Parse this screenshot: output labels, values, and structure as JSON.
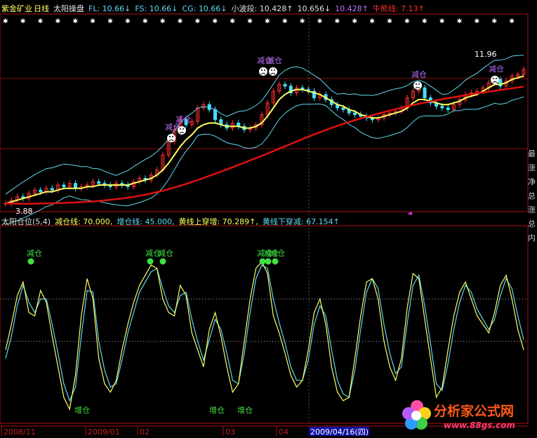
{
  "header": {
    "stock_name": "紫金矿业",
    "period": "日线",
    "indicator": "太阳操盘",
    "fl": "FL: 10.66↓",
    "fs": "FS: 10.66↓",
    "cg": "CG: 10.66↓",
    "xiaobo_label": "小波段: 10.428↑",
    "v2": "10.656↓",
    "v3": "10.428↑",
    "niu": "牛熊线: 7.13↑"
  },
  "upper": {
    "high_label": "11.96",
    "low_label": "3.88",
    "annotations": [
      "减仓",
      "减仓",
      "减仓",
      "减仓",
      "减仓",
      "减仓",
      "减仓"
    ]
  },
  "lower": {
    "header": {
      "name": "太阳仓位(5,4)",
      "jian": "减仓线: 70.000,",
      "zeng": "增仓线: 45.000,",
      "up": "黄线上穿增: 70.289↑,",
      "down": "黄线下穿减: 67.154↑"
    },
    "jian_labels": [
      "减仓",
      "减仓",
      "减仓",
      "减仓",
      "减仓",
      "减仓"
    ],
    "zeng_labels": [
      "增仓",
      "增仓",
      "增仓"
    ]
  },
  "xaxis": {
    "labels": [
      "2008/11",
      "2009/01",
      "02",
      "03",
      "04",
      "2009/04/16(四)"
    ]
  },
  "right_side_text": "最\n涨\n净\n总\n涨\n总\n内",
  "logo": {
    "name": "分析家公式网",
    "url": "www.88gs.com"
  },
  "colors": {
    "up": "#ff3030",
    "down": "#40e0ff",
    "yellow": "#ffff60",
    "cyan": "#60d8f0",
    "red_line": "#e01010",
    "green": "#40e040",
    "white": "#ffffff",
    "purple": "#c070ff"
  },
  "chart_data": [
    {
      "type": "candlestick",
      "title": "太阳操盘",
      "y_range": [
        3.88,
        11.96
      ],
      "series_note": "daily candles with yellow/cyan moving lines and red 牛熊线",
      "close": [
        3.9,
        4.1,
        4.3,
        4.2,
        4.5,
        4.7,
        4.6,
        4.8,
        4.7,
        5.0,
        4.9,
        5.1,
        4.8,
        4.9,
        5.0,
        5.2,
        5.1,
        5.0,
        4.9,
        5.1,
        5.0,
        4.9,
        5.2,
        5.4,
        5.3,
        5.6,
        5.9,
        6.8,
        7.6,
        8.3,
        8.9,
        8.6,
        8.8,
        9.6,
        9.8,
        9.5,
        8.9,
        8.6,
        8.4,
        8.7,
        8.5,
        8.3,
        8.4,
        8.6,
        9.2,
        9.9,
        10.6,
        11.0,
        10.9,
        10.5,
        10.8,
        10.7,
        10.6,
        10.2,
        10.4,
        10.1,
        9.8,
        9.6,
        9.5,
        9.3,
        9.2,
        9.1,
        9.0,
        8.9,
        9.0,
        9.2,
        9.3,
        9.4,
        9.6,
        10.2,
        10.6,
        10.8,
        10.2,
        9.9,
        9.7,
        9.6,
        9.5,
        9.8,
        10.1,
        10.4,
        10.5,
        10.6,
        10.8,
        11.1,
        11.3,
        10.9,
        11.2,
        11.5,
        11.6,
        11.9
      ],
      "yellow_line": [
        3.9,
        4.0,
        4.1,
        4.2,
        4.3,
        4.4,
        4.5,
        4.6,
        4.6,
        4.7,
        4.8,
        4.8,
        4.8,
        4.8,
        4.9,
        4.9,
        5.0,
        5.0,
        5.0,
        5.0,
        5.0,
        5.0,
        5.1,
        5.2,
        5.3,
        5.4,
        5.6,
        5.9,
        6.3,
        6.8,
        7.3,
        7.7,
        8.0,
        8.4,
        8.6,
        8.7,
        8.7,
        8.6,
        8.5,
        8.5,
        8.5,
        8.4,
        8.4,
        8.5,
        8.7,
        9.1,
        9.6,
        10.1,
        10.4,
        10.6,
        10.7,
        10.7,
        10.6,
        10.5,
        10.4,
        10.2,
        10.0,
        9.8,
        9.7,
        9.5,
        9.4,
        9.2,
        9.1,
        9.0,
        9.0,
        9.1,
        9.2,
        9.3,
        9.4,
        9.6,
        9.9,
        10.1,
        10.1,
        10.0,
        9.9,
        9.8,
        9.8,
        9.9,
        10.0,
        10.2,
        10.3,
        10.4,
        10.6,
        10.8,
        11.0,
        11.0,
        11.1,
        11.3,
        11.4,
        11.5
      ],
      "red_line": [
        3.9,
        3.9,
        3.88,
        3.88,
        3.88,
        3.89,
        3.9,
        3.9,
        3.91,
        3.92,
        3.93,
        3.95,
        3.96,
        3.98,
        4.0,
        4.02,
        4.05,
        4.08,
        4.12,
        4.16,
        4.2,
        4.25,
        4.3,
        4.36,
        4.42,
        4.5,
        4.58,
        4.66,
        4.75,
        4.85,
        4.96,
        5.07,
        5.18,
        5.3,
        5.42,
        5.55,
        5.68,
        5.8,
        5.93,
        6.06,
        6.2,
        6.33,
        6.47,
        6.6,
        6.74,
        6.88,
        7.02,
        7.17,
        7.31,
        7.45,
        7.6,
        7.74,
        7.88,
        8.02,
        8.15,
        8.28,
        8.41,
        8.53,
        8.65,
        8.76,
        8.87,
        8.97,
        9.07,
        9.17,
        9.26,
        9.35,
        9.44,
        9.53,
        9.61,
        9.69,
        9.77,
        9.85,
        9.92,
        9.99,
        10.06,
        10.12,
        10.18,
        10.24,
        10.3,
        10.36,
        10.42,
        10.47,
        10.52,
        10.57,
        10.62,
        10.67,
        10.72,
        10.77,
        10.82,
        10.87
      ]
    },
    {
      "type": "line",
      "title": "太阳仓位(5,4)",
      "y_range": [
        0,
        100
      ],
      "reference_lines": [
        70,
        45
      ],
      "yellow": [
        40,
        55,
        72,
        80,
        62,
        60,
        75,
        68,
        48,
        30,
        12,
        5,
        25,
        60,
        82,
        70,
        35,
        20,
        15,
        22,
        40,
        55,
        68,
        78,
        84,
        90,
        88,
        70,
        62,
        60,
        78,
        72,
        50,
        40,
        30,
        52,
        62,
        48,
        30,
        15,
        20,
        45,
        70,
        88,
        92,
        85,
        60,
        50,
        38,
        25,
        18,
        22,
        40,
        62,
        70,
        55,
        30,
        15,
        10,
        12,
        35,
        60,
        80,
        82,
        70,
        45,
        30,
        22,
        35,
        65,
        85,
        82,
        58,
        35,
        12,
        18,
        40,
        60,
        74,
        80,
        70,
        60,
        55,
        50,
        62,
        78,
        84,
        70,
        52,
        40
      ],
      "cyan": [
        35,
        48,
        66,
        78,
        68,
        62,
        70,
        70,
        55,
        38,
        20,
        10,
        18,
        48,
        75,
        74,
        45,
        28,
        18,
        20,
        34,
        50,
        62,
        74,
        80,
        86,
        88,
        76,
        66,
        62,
        72,
        74,
        58,
        45,
        34,
        46,
        58,
        52,
        38,
        22,
        20,
        38,
        62,
        82,
        90,
        88,
        70,
        56,
        44,
        30,
        22,
        22,
        34,
        55,
        66,
        60,
        40,
        22,
        14,
        12,
        28,
        52,
        74,
        82,
        76,
        55,
        38,
        26,
        30,
        56,
        78,
        84,
        66,
        44,
        20,
        16,
        32,
        52,
        68,
        78,
        74,
        64,
        58,
        52,
        58,
        72,
        82,
        76,
        60,
        46
      ]
    }
  ]
}
